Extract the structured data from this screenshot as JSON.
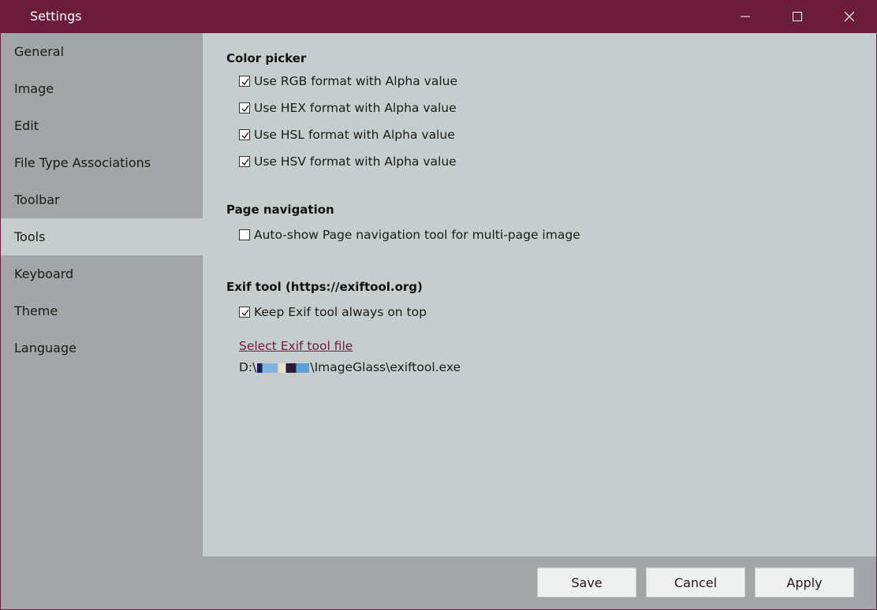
{
  "window": {
    "title": "Settings"
  },
  "sidebar": {
    "items": [
      {
        "label": "General"
      },
      {
        "label": "Image"
      },
      {
        "label": "Edit"
      },
      {
        "label": "File Type Associations"
      },
      {
        "label": "Toolbar"
      },
      {
        "label": "Tools",
        "active": true
      },
      {
        "label": "Keyboard"
      },
      {
        "label": "Theme"
      },
      {
        "label": "Language"
      }
    ]
  },
  "color_picker": {
    "title": "Color picker",
    "options": [
      {
        "label": "Use RGB format with Alpha value",
        "checked": true
      },
      {
        "label": "Use HEX format with Alpha value",
        "checked": true
      },
      {
        "label": "Use HSL format with Alpha value",
        "checked": true
      },
      {
        "label": "Use HSV format with Alpha value",
        "checked": true
      }
    ]
  },
  "page_navigation": {
    "title": "Page navigation",
    "options": [
      {
        "label": "Auto-show Page navigation tool for multi-page image",
        "checked": false
      }
    ]
  },
  "exif_tool": {
    "title": "Exif tool (https://exiftool.org)",
    "options": [
      {
        "label": "Keep Exif tool always on top",
        "checked": true
      }
    ],
    "select_link": "Select Exif tool file",
    "path_prefix": "D:\\",
    "path_suffix": "\\ImageGlass\\exiftool.exe"
  },
  "footer": {
    "save_label": "Save",
    "cancel_label": "Cancel",
    "apply_label": "Apply"
  },
  "colors": {
    "accent": "#6b1c3b",
    "sidebar_bg": "#a2a6a6",
    "content_bg": "#c6cecd"
  }
}
